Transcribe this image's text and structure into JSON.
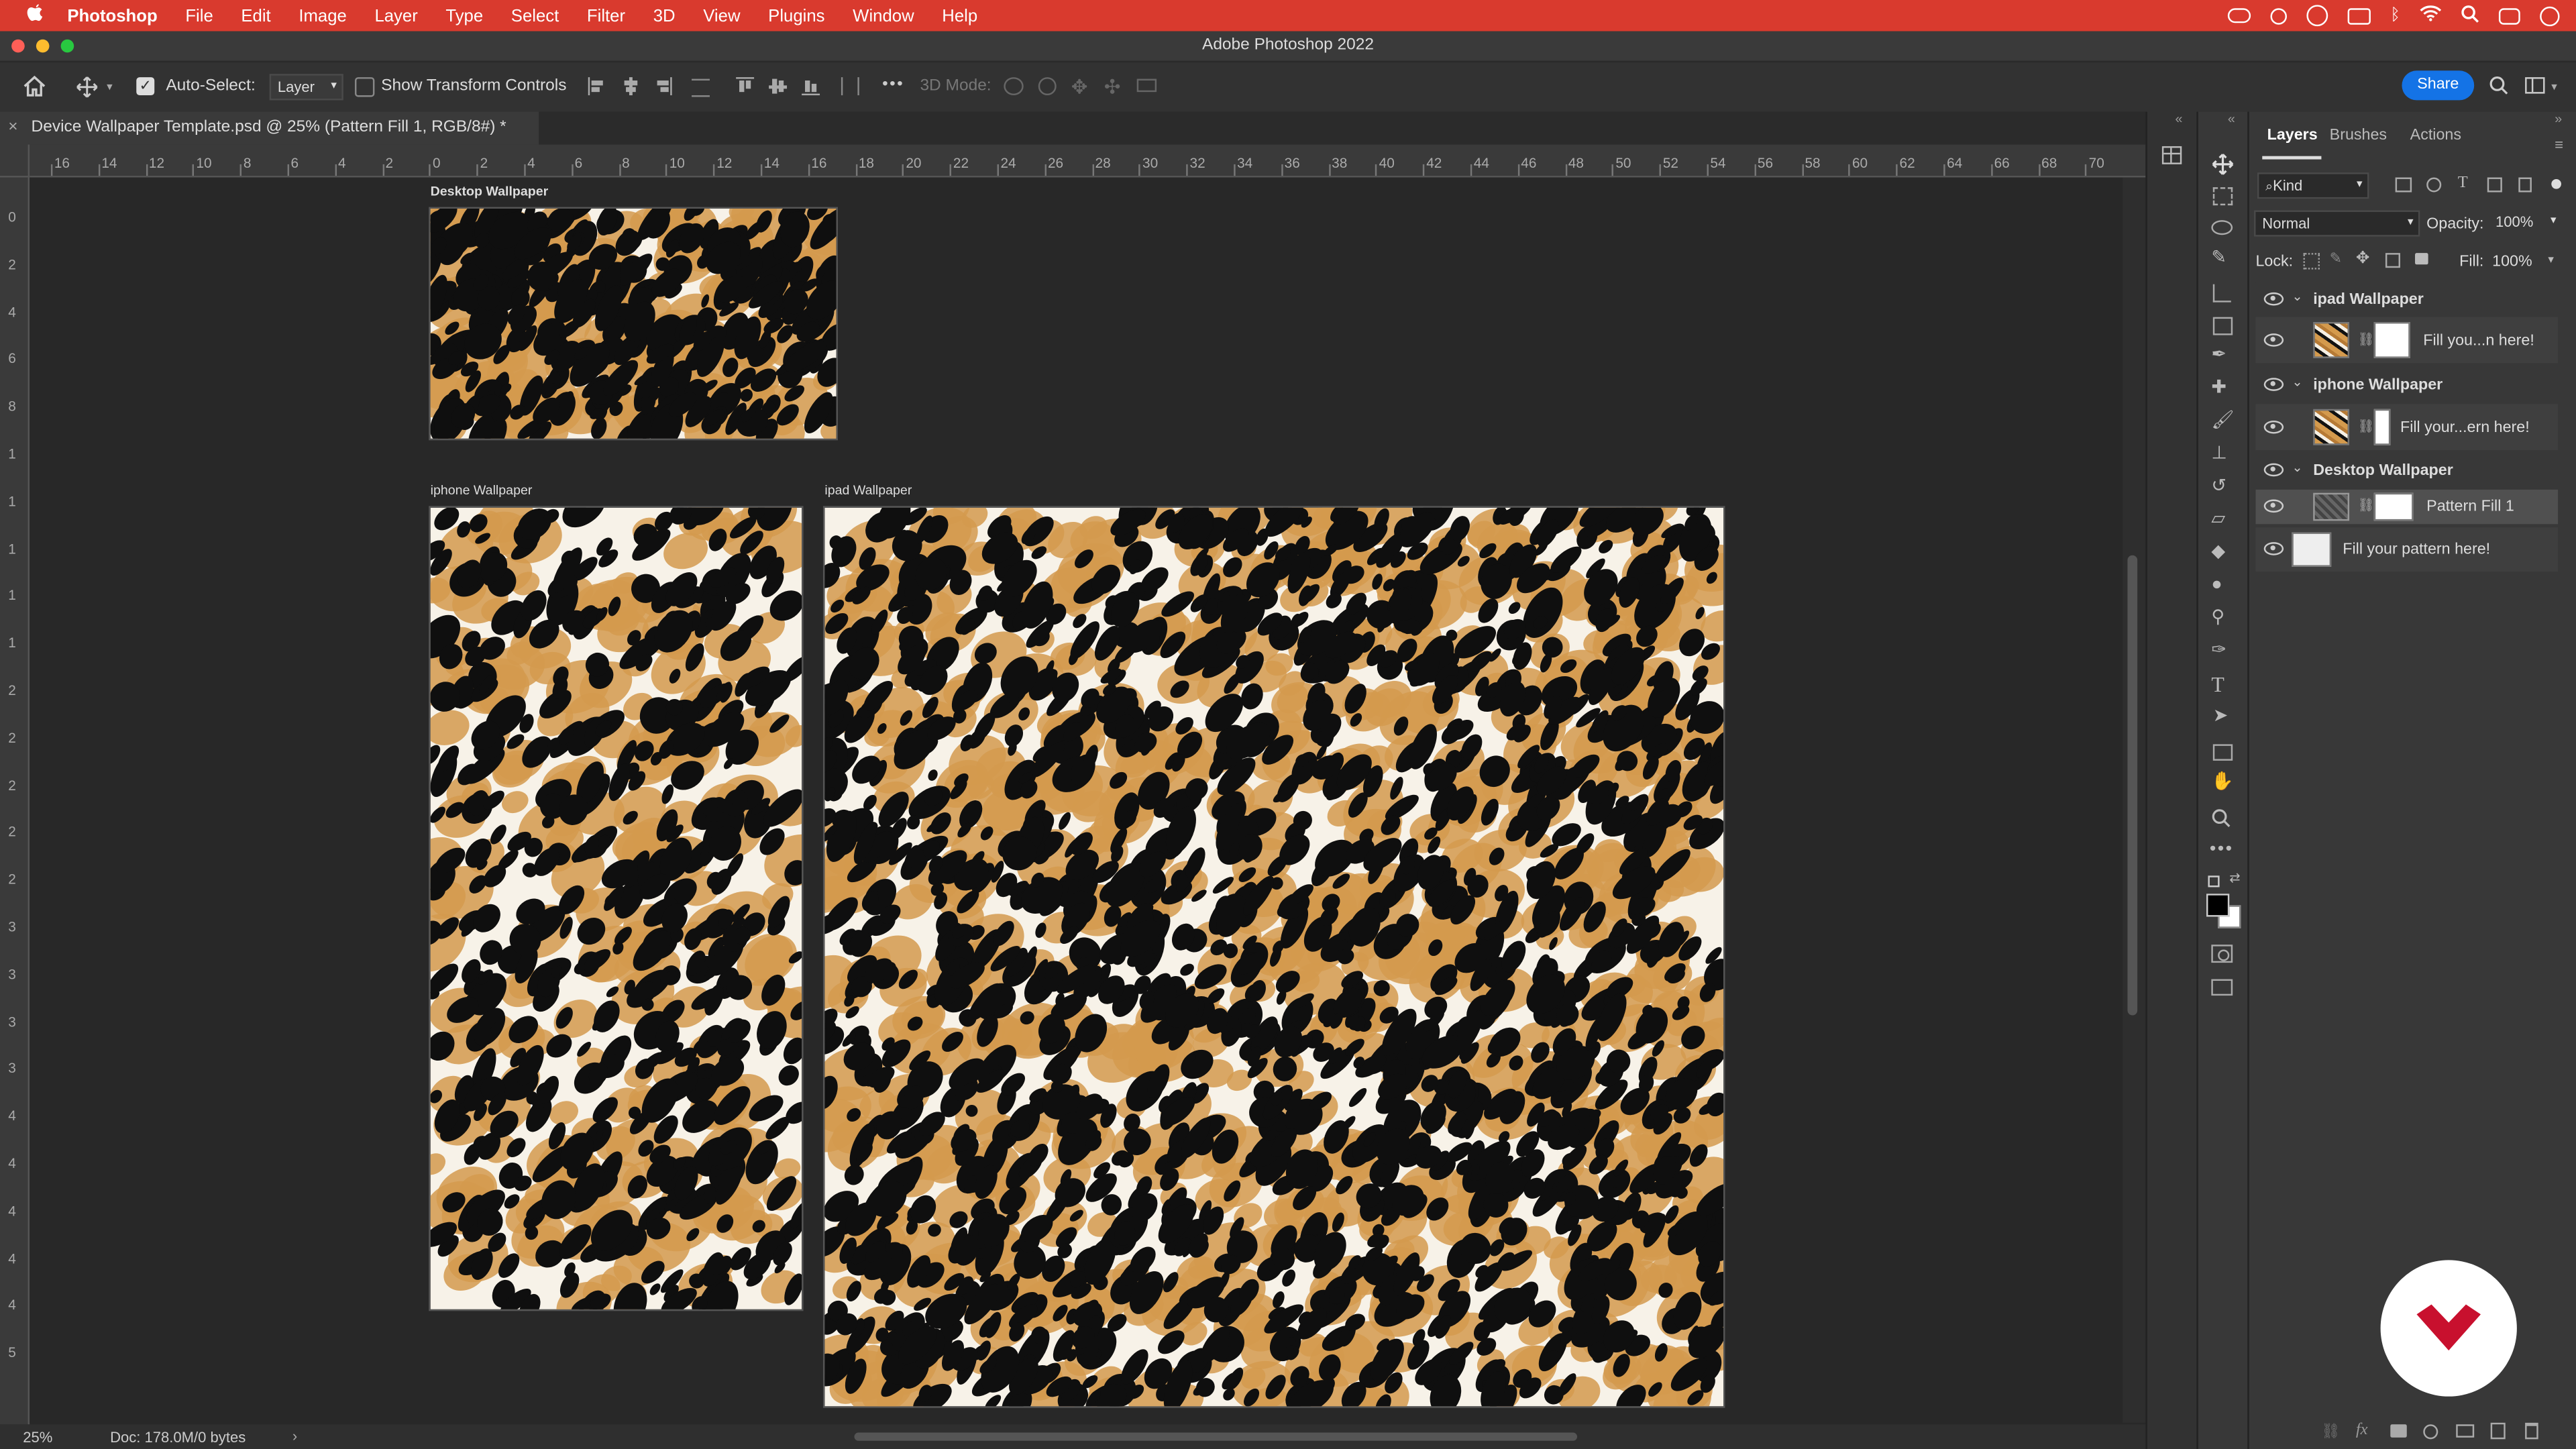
{
  "menubar": {
    "apple": "",
    "app": "Photoshop",
    "items": [
      "File",
      "Edit",
      "Image",
      "Layer",
      "Type",
      "Select",
      "Filter",
      "3D",
      "View",
      "Plugins",
      "Window",
      "Help"
    ],
    "bg_color": "#d93a2e"
  },
  "window": {
    "title": "Adobe Photoshop 2022"
  },
  "options_bar": {
    "auto_select_label": "Auto-Select:",
    "auto_select_checked": true,
    "auto_select_target": "Layer",
    "show_transform_label": "Show Transform Controls",
    "show_transform_checked": false,
    "more": "•••",
    "mode_3d_label": "3D Mode:",
    "share_label": "Share",
    "share_color": "#1473e6"
  },
  "document": {
    "tab_title": "Device Wallpaper Template.psd @ 25% (Pattern Fill 1, RGB/8#) *",
    "close_icon": "×"
  },
  "ruler": {
    "top_ticks": [
      "16",
      "14",
      "12",
      "10",
      "8",
      "6",
      "4",
      "2",
      "0",
      "2",
      "4",
      "6",
      "8",
      "10",
      "12",
      "14",
      "16",
      "18",
      "20",
      "22",
      "24",
      "26",
      "28",
      "30",
      "32",
      "34",
      "36",
      "38",
      "40",
      "42",
      "44",
      "46",
      "48",
      "50",
      "52",
      "54",
      "56",
      "58",
      "60",
      "62",
      "64",
      "66",
      "68",
      "70"
    ],
    "left_ticks": [
      "0",
      "2",
      "4",
      "6",
      "8",
      "1",
      "1",
      "1",
      "1",
      "1",
      "2",
      "2",
      "2",
      "2",
      "2",
      "3",
      "3",
      "3",
      "3",
      "4",
      "4",
      "4",
      "4",
      "4",
      "5"
    ]
  },
  "artboards": [
    {
      "label": "Desktop Wallpaper"
    },
    {
      "label": "iphone Wallpaper"
    },
    {
      "label": "ipad Wallpaper"
    }
  ],
  "status": {
    "zoom": "25%",
    "doc_info": "Doc: 178.0M/0 bytes",
    "arrow": "›"
  },
  "panel": {
    "tabs": [
      "Layers",
      "Brushes",
      "Actions"
    ],
    "active_tab": "Layers",
    "kind_label": "Kind",
    "blend_mode": "Normal",
    "opacity_label": "Opacity:",
    "opacity_value": "100%",
    "lock_label": "Lock:",
    "fill_label": "Fill:",
    "fill_value": "100%",
    "layers": [
      {
        "type": "group",
        "name": "ipad Wallpaper",
        "visible": true
      },
      {
        "type": "layer",
        "name": "Fill you...n here!",
        "visible": true,
        "indent": 1
      },
      {
        "type": "group",
        "name": "iphone Wallpaper",
        "visible": true
      },
      {
        "type": "layer",
        "name": "Fill your...ern here!",
        "visible": true,
        "indent": 1
      },
      {
        "type": "group",
        "name": "Desktop Wallpaper",
        "visible": true
      },
      {
        "type": "layer",
        "name": "Pattern Fill 1",
        "visible": true,
        "indent": 1,
        "selected": true
      },
      {
        "type": "layer",
        "name": "Fill your pattern here!",
        "visible": true,
        "indent": 0
      }
    ]
  },
  "colors": {
    "leopard_light": "#d49a4d",
    "leopard_dark": "#0f0f0f",
    "leopard_bg": "#f7f2e8",
    "brand_red": "#c8102e"
  }
}
